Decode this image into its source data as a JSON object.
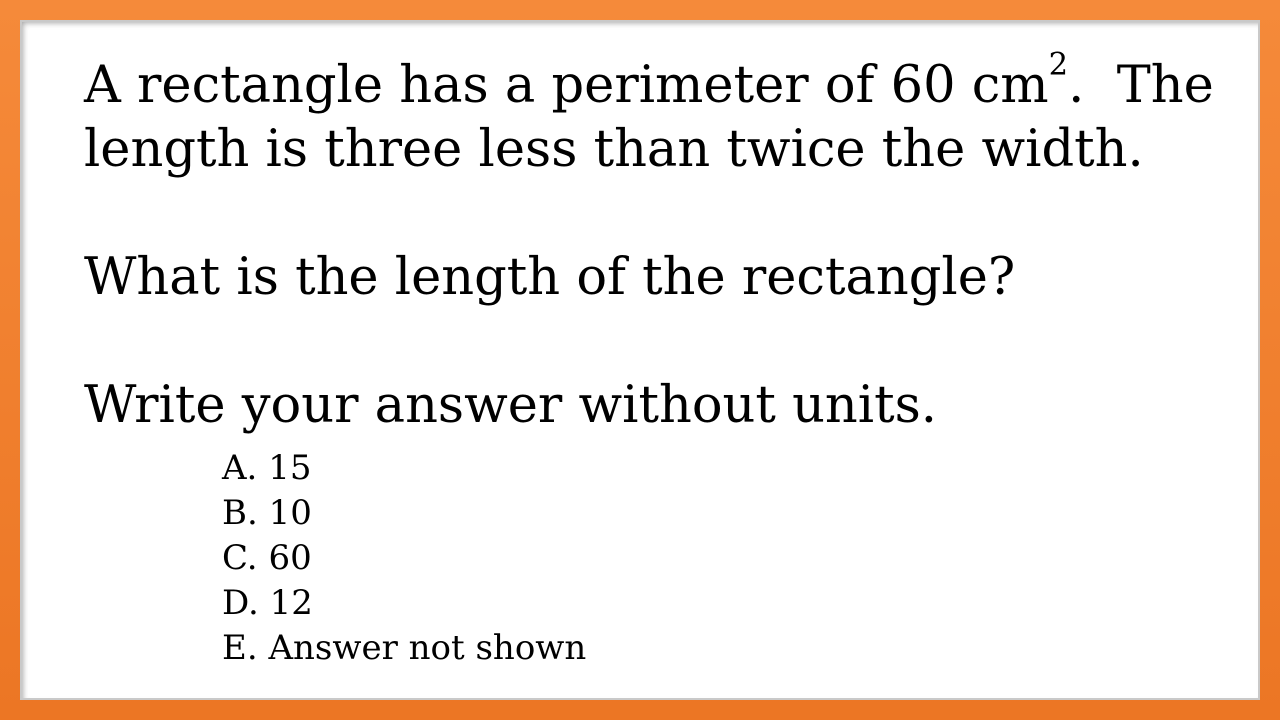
{
  "question": {
    "line1_before_sup": "A rectangle has a perimeter of 60 cm",
    "line1_sup": "2",
    "line1_after_sup": ".  The",
    "line2": "length is three less than twice the width.",
    "prompt": "What is the length of the rectangle?",
    "instruction": "Write your answer without units."
  },
  "choices": [
    {
      "letter": "A.",
      "text": "15"
    },
    {
      "letter": "B.",
      "text": "10"
    },
    {
      "letter": "C.",
      "text": "60"
    },
    {
      "letter": "D.",
      "text": "12"
    },
    {
      "letter": "E.",
      "text": "Answer not shown"
    }
  ],
  "colors": {
    "border": "#f07e2a",
    "background": "#ffffff",
    "text": "#000000"
  }
}
